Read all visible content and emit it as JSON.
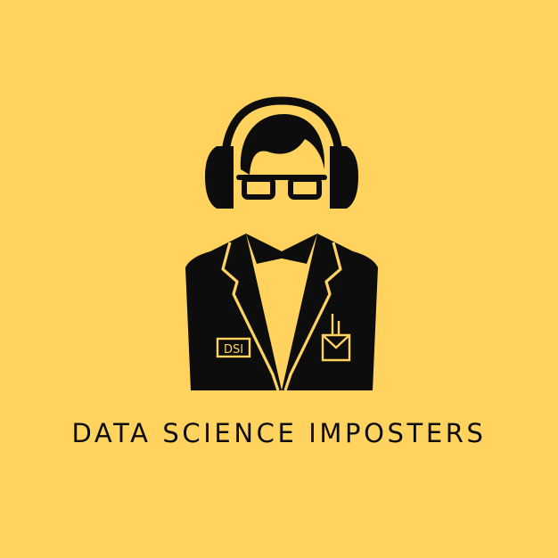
{
  "brand": {
    "title": "DATA SCIENCE IMPOSTERS",
    "badge_text": "DSI"
  },
  "colors": {
    "background": "#ffd35e",
    "ink": "#0d0d0d",
    "accent": "#ffd35e"
  },
  "icons": {
    "mascot": "headphones-glasses-labcoat-icon"
  }
}
